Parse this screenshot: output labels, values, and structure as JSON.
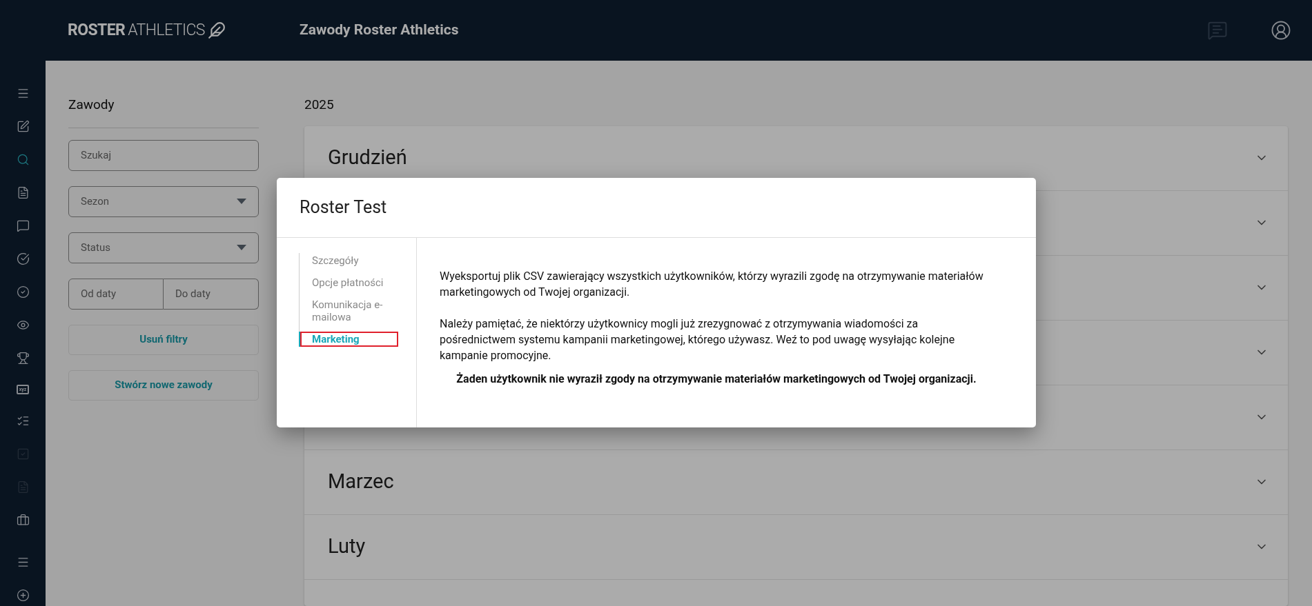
{
  "header": {
    "logo_bold": "ROSTER",
    "logo_light": "ATHLETICS",
    "title": "Zawody Roster Athletics"
  },
  "sidebar": {
    "items": [
      {
        "kind": "menu",
        "selected": false,
        "disabled": false
      },
      {
        "kind": "edit",
        "selected": false,
        "disabled": false
      },
      {
        "kind": "search",
        "selected": true,
        "disabled": false
      },
      {
        "kind": "list",
        "selected": false,
        "disabled": false
      },
      {
        "kind": "chat",
        "selected": false,
        "disabled": false
      },
      {
        "kind": "check-circle",
        "selected": false,
        "disabled": false
      },
      {
        "kind": "check",
        "selected": false,
        "disabled": false
      },
      {
        "kind": "eye",
        "selected": false,
        "disabled": false
      },
      {
        "kind": "trophy",
        "selected": false,
        "disabled": false
      },
      {
        "kind": "xyz",
        "selected": false,
        "disabled": false
      },
      {
        "kind": "bullet-list",
        "selected": false,
        "disabled": false
      },
      {
        "kind": "checkbox",
        "selected": false,
        "disabled": true
      },
      {
        "kind": "list",
        "selected": false,
        "disabled": true
      },
      {
        "kind": "briefcase",
        "selected": false,
        "disabled": false
      }
    ],
    "bottom_items": [
      {
        "kind": "menu"
      },
      {
        "kind": "plus"
      }
    ],
    "xyz_label": "xyz"
  },
  "filters": {
    "title": "Zawody",
    "search": {
      "placeholder": "Szukaj"
    },
    "selects": [
      {
        "placeholder": "Sezon"
      },
      {
        "placeholder": "Status"
      }
    ],
    "date_from": {
      "placeholder": "Od daty"
    },
    "date_to": {
      "placeholder": "Do daty"
    },
    "buttons": [
      "Usuń filtry",
      "Stwórz nowe zawody"
    ]
  },
  "content": {
    "year": "2025",
    "months": [
      {
        "title": "Grudzień",
        "expanded": false
      },
      {
        "expanded": false
      },
      {
        "expanded": false
      },
      {
        "expanded": false
      },
      {
        "expanded": false
      },
      {
        "title": "Marzec",
        "expanded": false
      },
      {
        "title": "Luty",
        "expanded": false
      }
    ]
  },
  "modal": {
    "title": "Roster Test",
    "nav": [
      {
        "label": "Szczegóły",
        "selected": false,
        "highlighted": false
      },
      {
        "label": "Opcje płatności",
        "selected": false,
        "highlighted": false
      },
      {
        "label": "Komunikacja e-mailowa",
        "selected": false,
        "highlighted": false
      },
      {
        "label": "Marketing",
        "selected": true,
        "highlighted": true
      }
    ],
    "paragraphs": [
      "Wyeksportuj plik CSV zawierający wszystkich użytkowników, którzy wyrazili zgodę na otrzymywanie materiałów marketingowych od Twojej organizacji.",
      "Należy pamiętać, że niektórzy użytkownicy mogli już zrezygnować z otrzymywania wiadomości za pośrednictwem systemu kampanii marketingowej, którego używasz. Weź to pod uwagę wysyłając kolejne kampanie promocyjne."
    ],
    "notice": "Żaden użytkownik nie wyraził zgody na otrzymywanie materiałów marketingowych od Twojej organizacji."
  }
}
